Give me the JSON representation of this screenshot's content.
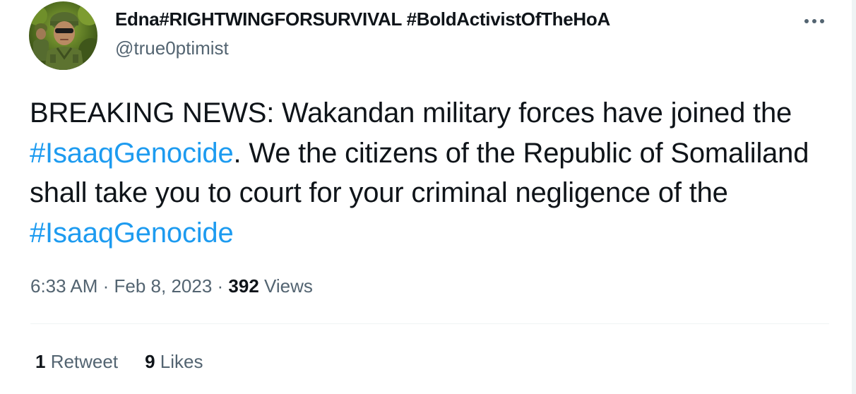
{
  "author": {
    "display_name": "Edna#RIGHTWINGFORSURVIVAL #BoldActivistOfTheHoA",
    "handle": "@true0ptimist"
  },
  "tweet": {
    "text_part1": "BREAKING NEWS: Wakandan military forces have joined the ",
    "hashtag1": "#IsaaqGenocide",
    "text_part2": ". We the citizens of the Republic of Somaliland shall take you to court for your criminal negligence of the ",
    "hashtag2": "#IsaaqGenocide"
  },
  "meta": {
    "time": "6:33 AM",
    "separator1": " · ",
    "date": "Feb 8, 2023",
    "separator2": " · ",
    "views_count": "392",
    "views_label": " Views"
  },
  "stats": {
    "retweets_count": "1",
    "retweets_label": " Retweet",
    "likes_count": "9",
    "likes_label": " Likes"
  },
  "icons": {
    "more": "more-horizontal-icon",
    "avatar": "profile-avatar"
  },
  "colors": {
    "hashtag": "#1d9bf0",
    "secondary_text": "#536471",
    "primary_text": "#0f1419",
    "divider": "#eff3f4"
  }
}
